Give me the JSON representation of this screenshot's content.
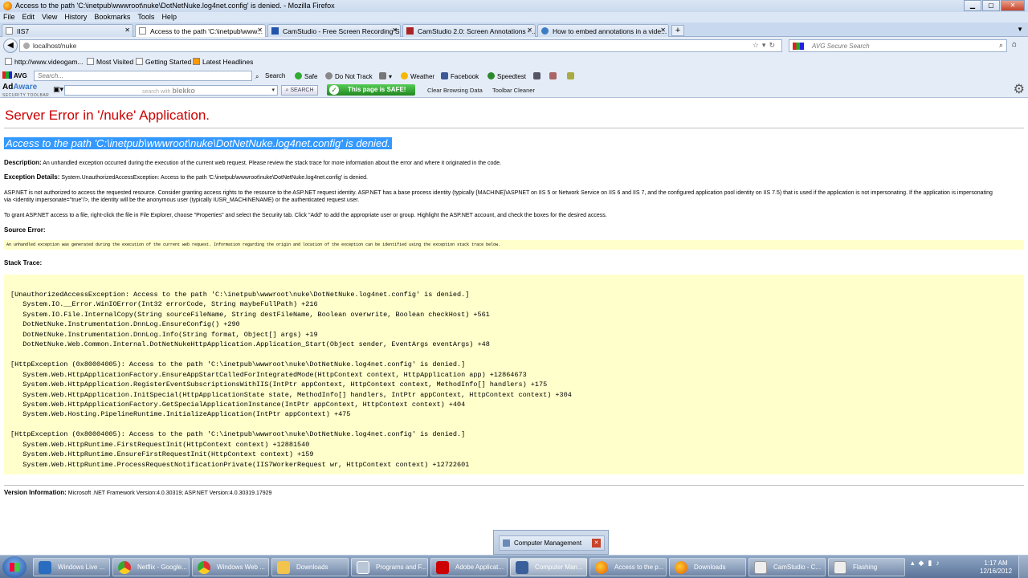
{
  "window": {
    "title": "Access to the path 'C:\\inetpub\\wwwroot\\nuke\\DotNetNuke.log4net.config' is denied. - Mozilla Firefox"
  },
  "menu": [
    "File",
    "Edit",
    "View",
    "History",
    "Bookmarks",
    "Tools",
    "Help"
  ],
  "tabs": [
    {
      "label": "IIS7"
    },
    {
      "label": "Access to the path 'C:\\inetpub\\www..."
    },
    {
      "label": "CamStudio - Free Screen Recording S..."
    },
    {
      "label": "CamStudio 2.0: Screen Annotations - ..."
    },
    {
      "label": "How to embed annotations in a vide..."
    }
  ],
  "nav": {
    "url": "localhost/nuke",
    "search_placeholder": "AVG Secure Search"
  },
  "bookmarks": [
    "http://www.videogam...",
    "Most Visited",
    "Getting Started",
    "Latest Headlines"
  ],
  "avg": {
    "logo": "AVG",
    "search_placeholder": "Search...",
    "items": [
      "Search",
      "Safe",
      "Do Not Track",
      "Weather",
      "Facebook",
      "Speedtest"
    ]
  },
  "adaware": {
    "logo_ad": "Ad",
    "logo_aware": "Aware",
    "logo_sub": "SECURITY TOOLBAR",
    "blekko_hint": "search with",
    "blekko_brand": "blekko",
    "search_btn": "SEARCH",
    "safe_badge": "This page is SAFE!",
    "clear_data": "Clear Browsing Data",
    "toolbar_cleaner": "Toolbar Cleaner"
  },
  "page": {
    "title": "Server Error in '/nuke' Application.",
    "heading": "Access to the path 'C:\\inetpub\\wwwroot\\nuke\\DotNetNuke.log4net.config' is denied.",
    "description_label": "Description:",
    "description": "An unhandled exception occurred during the execution of the current web request. Please review the stack trace for more information about the error and where it originated in the code.",
    "exception_label": "Exception Details:",
    "exception": "System.UnauthorizedAccessException: Access to the path 'C:\\inetpub\\wwwroot\\nuke\\DotNetNuke.log4net.config' is denied.",
    "para1": "ASP.NET is not authorized to access the requested resource. Consider granting access rights to the resource to the ASP.NET request identity. ASP.NET has a base process identity (typically {MACHINE}\\ASPNET on IIS 5 or Network Service on IIS 6 and IIS 7, and the configured application pool identity on IIS 7.5) that is used if the application is not impersonating. If the application is impersonating",
    "para1b": "via <identity impersonate=\"true\"/>, the identity will be the anonymous user (typically IUSR_MACHINENAME) or the authenticated request user.",
    "para2": "To grant ASP.NET access to a file, right-click the file in File Explorer, choose \"Properties\" and select the Security tab. Click \"Add\" to add the appropriate user or group. Highlight the ASP.NET account, and check the boxes for the desired access.",
    "source_label": "Source Error:",
    "source_text": "An unhandled exception was generated during the execution of the current web request. Information regarding the origin and location of the exception can be identified using the exception stack trace below.",
    "stack_label": "Stack Trace:",
    "stack_trace": "[UnauthorizedAccessException: Access to the path 'C:\\inetpub\\wwwroot\\nuke\\DotNetNuke.log4net.config' is denied.]\n   System.IO.__Error.WinIOError(Int32 errorCode, String maybeFullPath) +216\n   System.IO.File.InternalCopy(String sourceFileName, String destFileName, Boolean overwrite, Boolean checkHost) +561\n   DotNetNuke.Instrumentation.DnnLog.EnsureConfig() +290\n   DotNetNuke.Instrumentation.DnnLog.Info(String format, Object[] args) +19\n   DotNetNuke.Web.Common.Internal.DotNetNukeHttpApplication.Application_Start(Object sender, EventArgs eventArgs) +48\n\n[HttpException (0x80004005): Access to the path 'C:\\inetpub\\wwwroot\\nuke\\DotNetNuke.log4net.config' is denied.]\n   System.Web.HttpApplicationFactory.EnsureAppStartCalledForIntegratedMode(HttpContext context, HttpApplication app) +12864673\n   System.Web.HttpApplication.RegisterEventSubscriptionsWithIIS(IntPtr appContext, HttpContext context, MethodInfo[] handlers) +175\n   System.Web.HttpApplication.InitSpecial(HttpApplicationState state, MethodInfo[] handlers, IntPtr appContext, HttpContext context) +304\n   System.Web.HttpApplicationFactory.GetSpecialApplicationInstance(IntPtr appContext, HttpContext context) +404\n   System.Web.Hosting.PipelineRuntime.InitializeApplication(IntPtr appContext) +475\n\n[HttpException (0x80004005): Access to the path 'C:\\inetpub\\wwwroot\\nuke\\DotNetNuke.log4net.config' is denied.]\n   System.Web.HttpRuntime.FirstRequestInit(HttpContext context) +12881540\n   System.Web.HttpRuntime.EnsureFirstRequestInit(HttpContext context) +159\n   System.Web.HttpRuntime.ProcessRequestNotificationPrivate(IIS7WorkerRequest wr, HttpContext context) +12722601",
    "version_label": "Version Information:",
    "version": "Microsoft .NET Framework Version:4.0.30319; ASP.NET Version:4.0.30319.17929"
  },
  "taskbar": {
    "popup": "Computer Management",
    "items": [
      {
        "label": "Windows Live ...",
        "icon": "windows-live-icon"
      },
      {
        "label": "Netflix - Google...",
        "icon": "chrome-icon"
      },
      {
        "label": "Windows Web ...",
        "icon": "chrome-icon"
      },
      {
        "label": "Downloads",
        "icon": "folder-icon"
      },
      {
        "label": "Programs and F...",
        "icon": "programs-icon"
      },
      {
        "label": "Adobe Applicat...",
        "icon": "adobe-icon"
      },
      {
        "label": "Computer Man...",
        "icon": "computer-management-icon"
      },
      {
        "label": "Access to the p...",
        "icon": "firefox-icon"
      },
      {
        "label": "Downloads",
        "icon": "firefox-icon"
      },
      {
        "label": "CamStudio - C...",
        "icon": "camstudio-icon"
      },
      {
        "label": "Flashing",
        "icon": "camstudio-icon"
      }
    ],
    "time": "1:17 AM",
    "date": "12/16/2012"
  }
}
